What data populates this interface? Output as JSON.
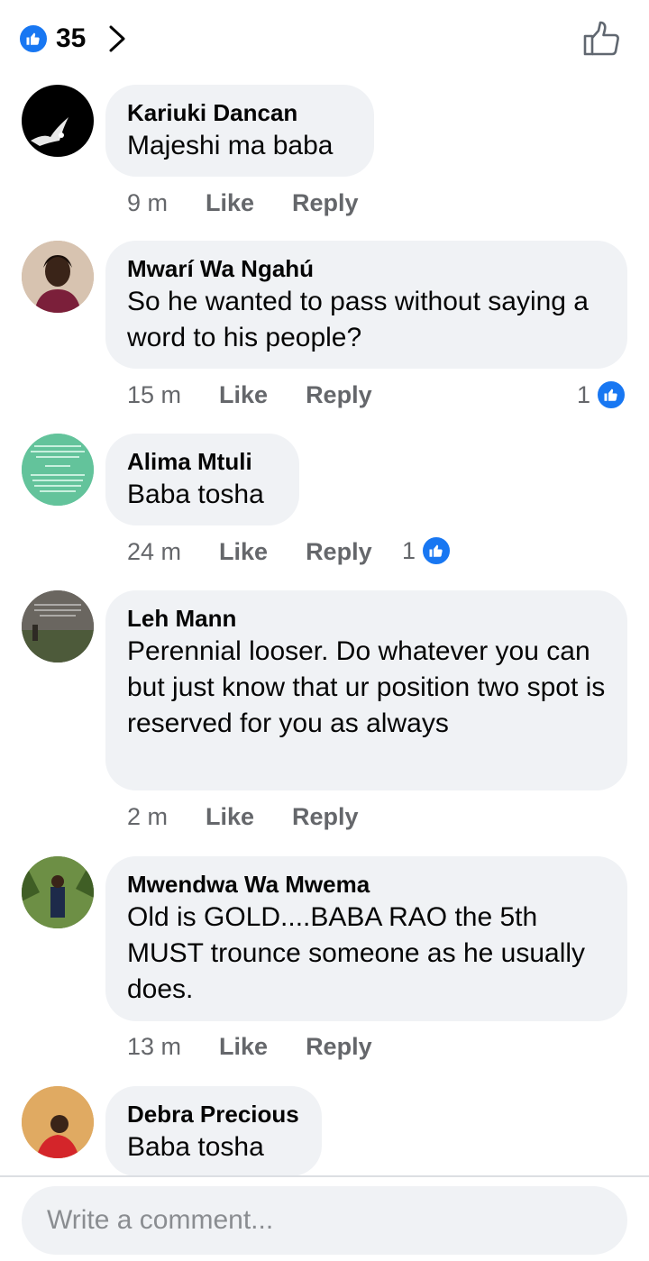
{
  "header": {
    "reaction_count": "35",
    "reaction_icon": "like-icon",
    "nav_icon": "chevron-right-icon",
    "action_icon": "thumbs-up-outline-icon"
  },
  "comments": [
    {
      "author": "Kariuki Dancan",
      "text": "Majeshi ma baba",
      "time": "9 m",
      "like_label": "Like",
      "reply_label": "Reply",
      "reactions": ""
    },
    {
      "author": "Mwarí Wa Ngahú",
      "text": "So he wanted to pass without saying a word to his people?",
      "time": "15 m",
      "like_label": "Like",
      "reply_label": "Reply",
      "reactions": "1"
    },
    {
      "author": "Alima Mtuli",
      "text": "Baba tosha",
      "time": "24 m",
      "like_label": "Like",
      "reply_label": "Reply",
      "reactions": "1"
    },
    {
      "author": "Leh Mann",
      "text": "Perennial looser. Do whatever you can but just know that ur position two spot is reserved for you as always",
      "time": "2 m",
      "like_label": "Like",
      "reply_label": "Reply",
      "reactions": ""
    },
    {
      "author": "Mwendwa Wa Mwema",
      "text": "Old is GOLD....BABA RAO the 5th MUST trounce someone as he usually does.",
      "time": "13 m",
      "like_label": "Like",
      "reply_label": "Reply",
      "reactions": ""
    },
    {
      "author": "Debra Precious",
      "text": "Baba tosha",
      "time": "",
      "like_label": "",
      "reply_label": "",
      "reactions": ""
    }
  ],
  "composer": {
    "placeholder": "Write a comment..."
  },
  "colors": {
    "accent": "#1877f2",
    "bubble": "#f0f2f5",
    "meta": "#65676b"
  }
}
